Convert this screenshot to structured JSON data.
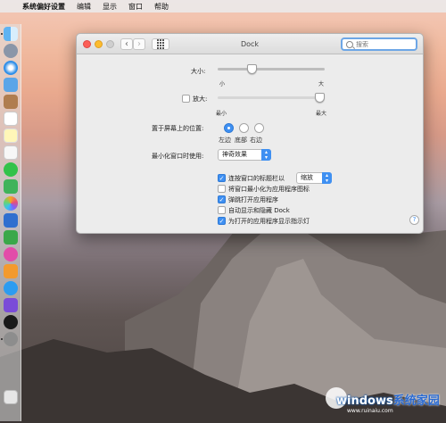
{
  "menubar": {
    "apple": "",
    "items": [
      "系统偏好设置",
      "编辑",
      "显示",
      "窗口",
      "帮助"
    ]
  },
  "window": {
    "title": "Dock",
    "search_placeholder": "搜索"
  },
  "size": {
    "label": "大小:",
    "min_label": "小",
    "max_label": "大",
    "value": 0.3
  },
  "magnification": {
    "label": "放大:",
    "checked": false,
    "min_label": "最小",
    "max_label": "最大",
    "value": 1.0
  },
  "position": {
    "label": "置于屏幕上的位置:",
    "options": [
      "左边",
      "底部",
      "右边"
    ],
    "selected": "左边"
  },
  "minimize": {
    "label": "最小化窗口时使用:",
    "value": "神奇效果"
  },
  "checkboxes": [
    {
      "label": "连按窗口的标题栏以",
      "checked": true
    },
    {
      "label": "将窗口最小化为应用程序图标",
      "checked": false
    },
    {
      "label": "弹跳打开应用程序",
      "checked": true
    },
    {
      "label": "自动显示和隐藏 Dock",
      "checked": false
    },
    {
      "label": "为打开的应用程序显示指示灯",
      "checked": true
    }
  ],
  "double_click_action": "缩放",
  "help": "?",
  "watermark": {
    "brand_white": "windows",
    "brand_blue": "系统家园",
    "url": "www.ruinaiu.com"
  },
  "colors": {
    "accent": "#3f90f2",
    "close": "#fc5f57",
    "minimize": "#fdbc2e"
  }
}
